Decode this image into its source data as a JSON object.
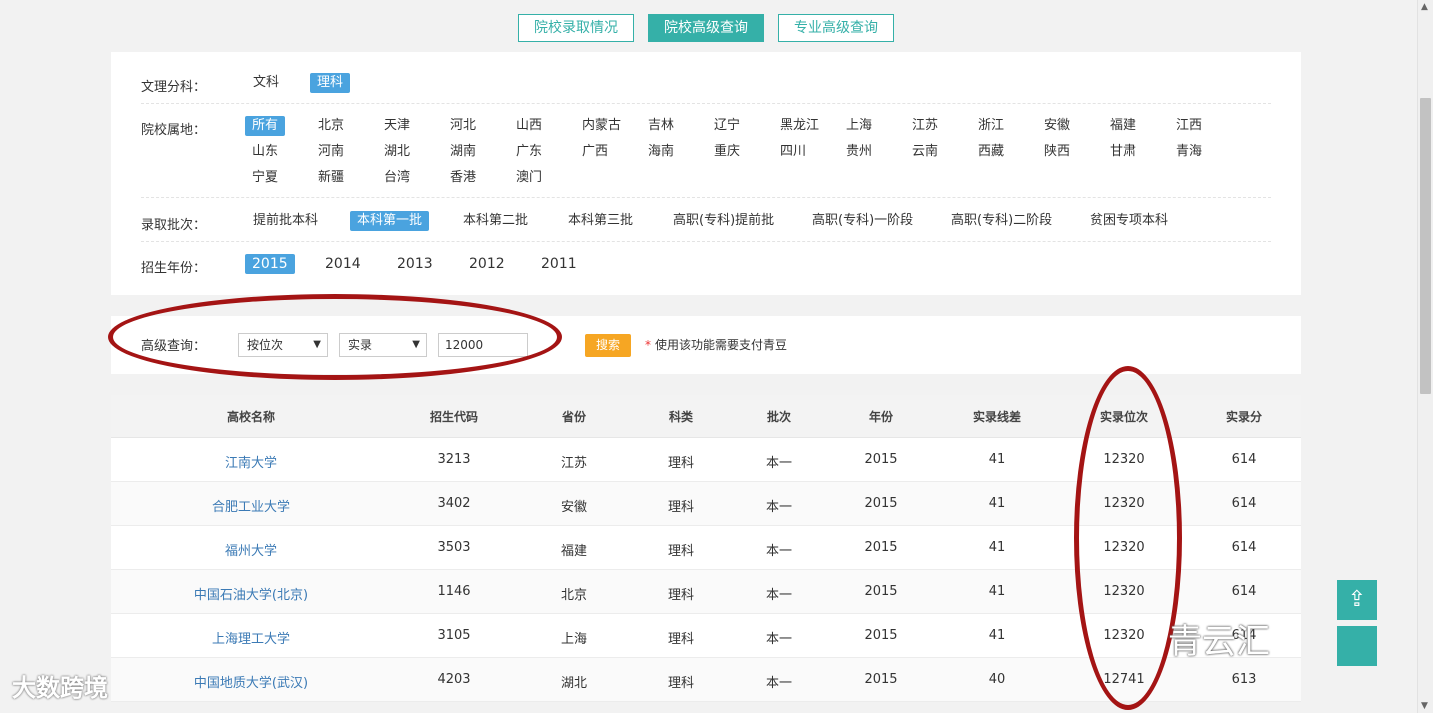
{
  "tabs": [
    {
      "label": "院校录取情况",
      "active": false
    },
    {
      "label": "院校高级查询",
      "active": true
    },
    {
      "label": "专业高级查询",
      "active": false
    }
  ],
  "filters": {
    "subject": {
      "label": "文理分科：",
      "options": [
        "文科",
        "理科"
      ],
      "selected": "理科"
    },
    "location": {
      "label": "院校属地：",
      "rows": [
        [
          "所有",
          "北京",
          "天津",
          "河北",
          "山西",
          "内蒙古",
          "吉林",
          "辽宁",
          "黑龙江",
          "上海",
          "江苏",
          "浙江",
          "安徽",
          "福建",
          "江西"
        ],
        [
          "山东",
          "河南",
          "湖北",
          "湖南",
          "广东",
          "广西",
          "海南",
          "重庆",
          "四川",
          "贵州",
          "云南",
          "西藏",
          "陕西",
          "甘肃",
          "青海"
        ],
        [
          "宁夏",
          "新疆",
          "台湾",
          "香港",
          "澳门"
        ]
      ],
      "selected": "所有"
    },
    "batch": {
      "label": "录取批次：",
      "options": [
        "提前批本科",
        "本科第一批",
        "本科第二批",
        "本科第三批",
        "高职(专科)提前批",
        "高职(专科)一阶段",
        "高职(专科)二阶段",
        "贫困专项本科"
      ],
      "selected": "本科第一批"
    },
    "year": {
      "label": "招生年份：",
      "options": [
        "2015",
        "2014",
        "2013",
        "2012",
        "2011"
      ],
      "selected": "2015"
    }
  },
  "advanced": {
    "label": "高级查询：",
    "mode_select": "按位次",
    "type_select": "实录",
    "value": "12000",
    "search_label": "搜索",
    "note_star": "*",
    "note": "使用该功能需要支付青豆"
  },
  "table": {
    "headers": [
      "高校名称",
      "招生代码",
      "省份",
      "科类",
      "批次",
      "年份",
      "实录线差",
      "实录位次",
      "实录分"
    ],
    "rows": [
      [
        "江南大学",
        "3213",
        "江苏",
        "理科",
        "本一",
        "2015",
        "41",
        "12320",
        "614"
      ],
      [
        "合肥工业大学",
        "3402",
        "安徽",
        "理科",
        "本一",
        "2015",
        "41",
        "12320",
        "614"
      ],
      [
        "福州大学",
        "3503",
        "福建",
        "理科",
        "本一",
        "2015",
        "41",
        "12320",
        "614"
      ],
      [
        "中国石油大学(北京)",
        "1146",
        "北京",
        "理科",
        "本一",
        "2015",
        "41",
        "12320",
        "614"
      ],
      [
        "上海理工大学",
        "3105",
        "上海",
        "理科",
        "本一",
        "2015",
        "41",
        "12320",
        "614"
      ],
      [
        "中国地质大学(武汉)",
        "4203",
        "湖北",
        "理科",
        "本一",
        "2015",
        "40",
        "12741",
        "613"
      ]
    ]
  },
  "watermarks": {
    "left": "大数跨境",
    "right": "青云汇"
  },
  "colors": {
    "teal": "#35b0a8",
    "blue_selected": "#4aa3df",
    "orange": "#f6a623",
    "ellipse_red": "#a41414",
    "link": "#3b7ab5"
  },
  "icons": {
    "to_top": "up-arrow-icon"
  }
}
